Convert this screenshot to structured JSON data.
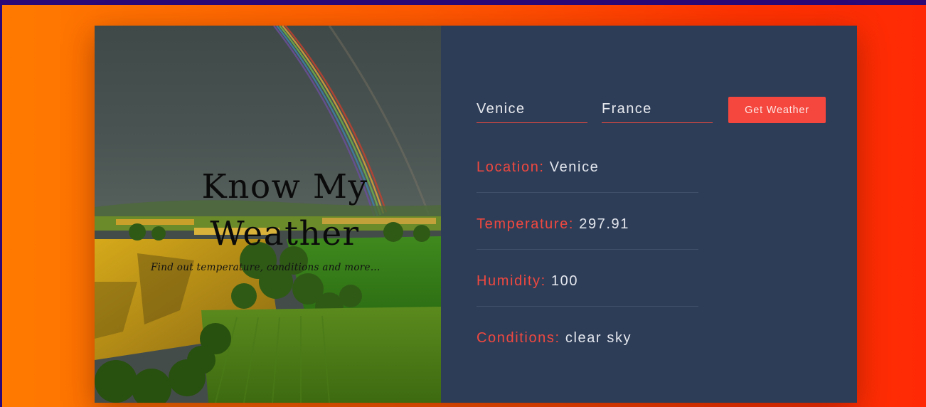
{
  "hero": {
    "title": "Know My Weather",
    "subtitle": "Find out temperature, conditions and more..."
  },
  "form": {
    "city_value": "Venice",
    "city_placeholder": "City...",
    "country_value": "France",
    "country_placeholder": "Country...",
    "submit_label": "Get Weather"
  },
  "results": [
    {
      "label": "Location:",
      "value": "Venice"
    },
    {
      "label": "Temperature:",
      "value": "297.91"
    },
    {
      "label": "Humidity:",
      "value": "100"
    },
    {
      "label": "Conditions:",
      "value": "clear sky"
    }
  ],
  "colors": {
    "accent": "#f5473d",
    "panel_bg": "#2e3d57",
    "page_gradient_start": "#ff7a00",
    "page_gradient_end": "#ff2a05",
    "top_bar": "#2b0a78"
  }
}
